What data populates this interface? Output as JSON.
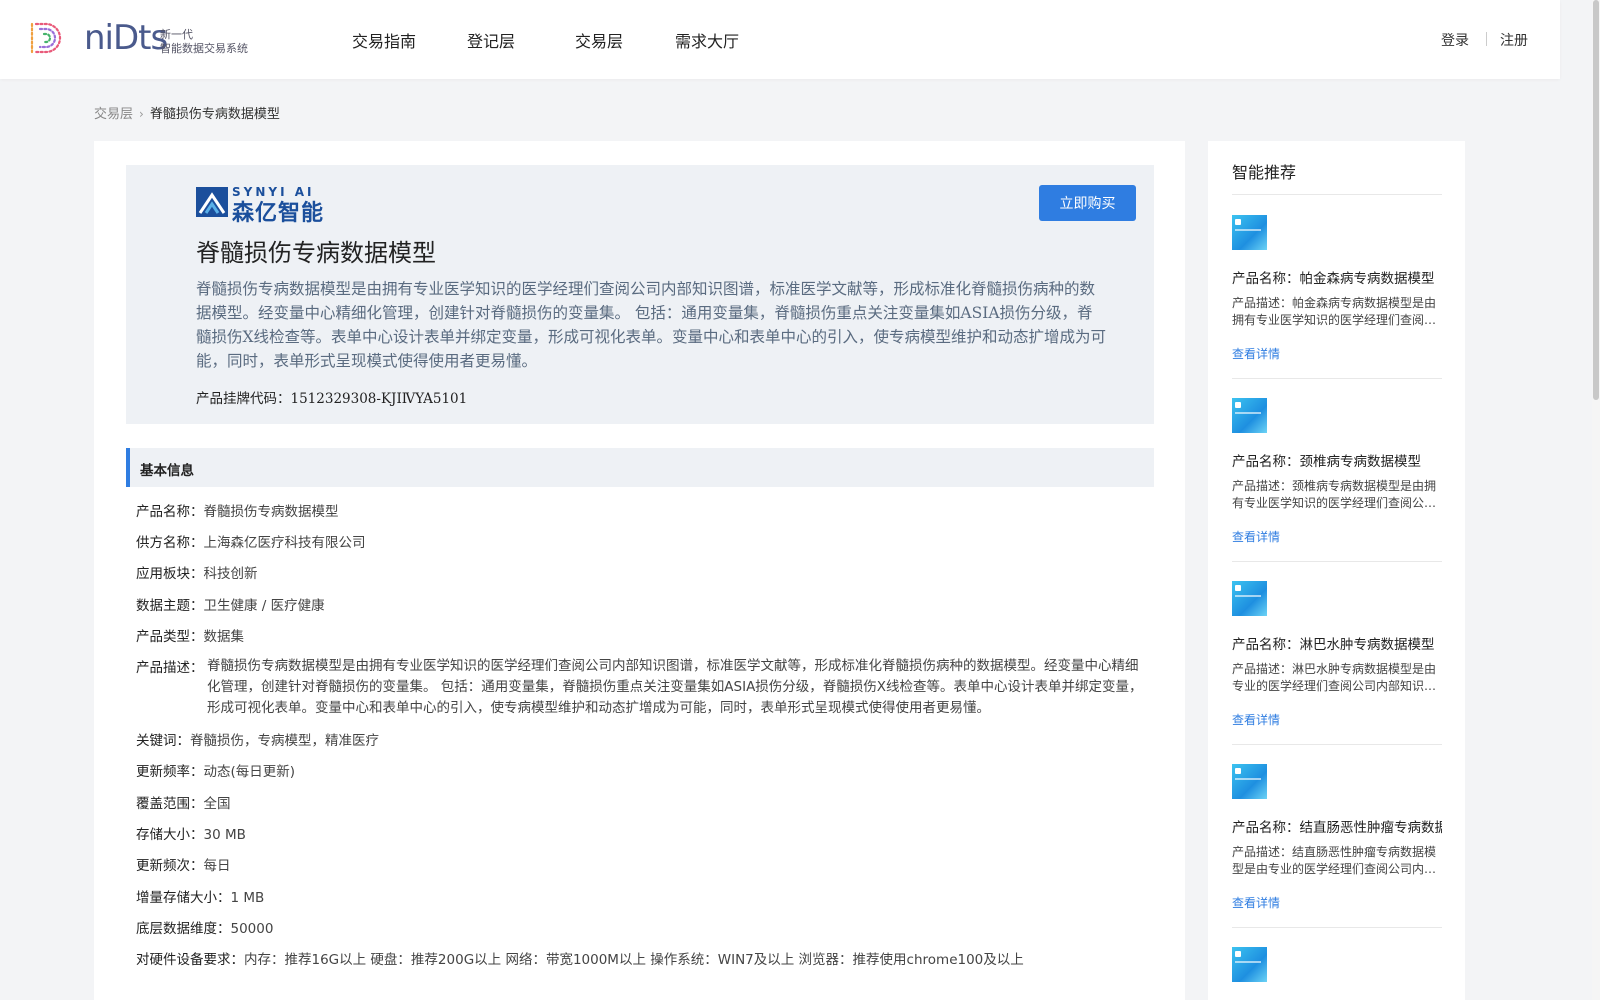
{
  "header": {
    "logo_text": "niDts",
    "logo_sub_line1": "新一代",
    "logo_sub_line2": "智能数据交易系统",
    "nav": [
      "交易指南",
      "登记层",
      "交易层",
      "需求大厅"
    ],
    "login": "登录",
    "register": "注册"
  },
  "breadcrumb": {
    "parent": "交易层",
    "current": "脊髓损伤专病数据模型"
  },
  "hero": {
    "brand_en": "SYNYI AI",
    "brand_cn": "森亿智能",
    "buy_label": "立即购买",
    "title": "脊髓损伤专病数据模型",
    "description": "脊髓损伤专病数据模型是由拥有专业医学知识的医学经理们查阅公司内部知识图谱，标准医学文献等，形成标准化脊髓损伤病种的数据模型。经变量中心精细化管理，创建针对脊髓损伤的变量集。 包括：通用变量集，脊髓损伤重点关注变量集如ASIA损伤分级，脊髓损伤X线检查等。表单中心设计表单并绑定变量，形成可视化表单。变量中心和表单中心的引入，使专病模型维护和动态扩增成为可能，同时，表单形式呈现模式使得使用者更易懂。",
    "code_label": "产品挂牌代码：",
    "code_value": "1512329308-KJIⅣYA5101"
  },
  "basic_info": {
    "section_title": "基本信息",
    "rows": [
      {
        "k": "产品名称：",
        "v": "脊髓损伤专病数据模型"
      },
      {
        "k": "供方名称：",
        "v": "上海森亿医疗科技有限公司"
      },
      {
        "k": "应用板块：",
        "v": "科技创新"
      },
      {
        "k": "数据主题：",
        "v": "卫生健康 / 医疗健康"
      },
      {
        "k": "产品类型：",
        "v": "数据集"
      },
      {
        "k": "产品描述：",
        "v": "脊髓损伤专病数据模型是由拥有专业医学知识的医学经理们查阅公司内部知识图谱，标准医学文献等，形成标准化脊髓损伤病种的数据模型。经变量中心精细化管理，创建针对脊髓损伤的变量集。 包括：通用变量集，脊髓损伤重点关注变量集如ASIA损伤分级，脊髓损伤X线检查等。表单中心设计表单并绑定变量，形成可视化表单。变量中心和表单中心的引入，使专病模型维护和动态扩增成为可能，同时，表单形式呈现模式使得使用者更易懂。"
      },
      {
        "k": "关键词：",
        "v": "脊髓损伤，专病模型，精准医疗"
      },
      {
        "k": "更新频率：",
        "v": "动态(每日更新)"
      },
      {
        "k": "覆盖范围：",
        "v": "全国"
      },
      {
        "k": "存储大小：",
        "v": "30 MB"
      },
      {
        "k": "更新频次：",
        "v": "每日"
      },
      {
        "k": "增量存储大小：",
        "v": "1 MB"
      },
      {
        "k": "底层数据维度：",
        "v": "50000"
      },
      {
        "k": "对硬件设备要求：",
        "v": "内存：推荐16G以上 硬盘：推荐200G以上 网络：带宽1000M以上 操作系统：WIN7及以上 浏览器：推荐使用chrome100及以上"
      }
    ]
  },
  "sidebar": {
    "title": "智能推荐",
    "items": [
      {
        "name": "产品名称：帕金森病专病数据模型",
        "desc": "产品描述：帕金森病专病数据模型是由拥有专业医学知识的医学经理们查阅公司内部知识图谱",
        "more": "查看详情"
      },
      {
        "name": "产品名称：颈椎病专病数据模型",
        "desc": "产品描述：颈椎病专病数据模型是由拥有专业医学知识的医学经理们查阅公司内部知识图谱",
        "more": "查看详情"
      },
      {
        "name": "产品名称：淋巴水肿专病数据模型",
        "desc": "产品描述：淋巴水肿专病数据模型是由专业的医学经理们查阅公司内部知识图谱",
        "more": "查看详情"
      },
      {
        "name": "产品名称：结直肠恶性肿瘤专病数据模型",
        "desc": "产品描述：结直肠恶性肿瘤专病数据模型是由专业的医学经理们查阅公司内部知识图谱",
        "more": "查看详情"
      }
    ]
  }
}
